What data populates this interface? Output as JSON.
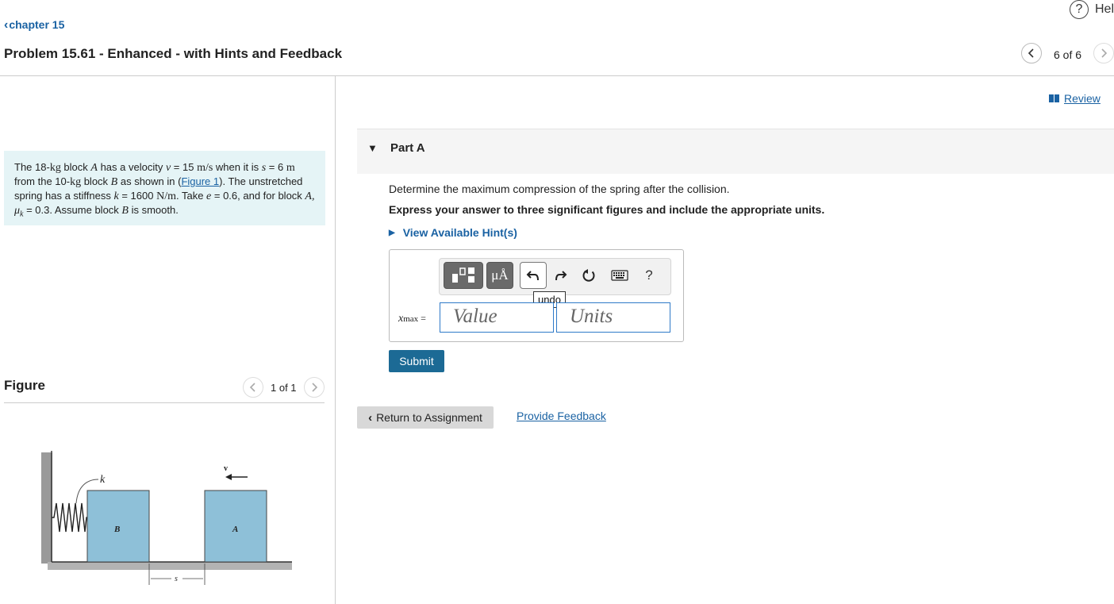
{
  "header": {
    "help_label": "Hel",
    "help_icon_glyph": "?",
    "back_label": "chapter 15",
    "title": "Problem 15.61 - Enhanced - with Hints and Feedback",
    "counter": "6 of 6",
    "review_label": "Review"
  },
  "statement": {
    "t1": "The 18-",
    "u_kg1": "kg",
    "t2": " block ",
    "A1": "A",
    "t3": " has a velocity ",
    "v": "v",
    "t4": " = 15 ",
    "u_mps": "m/s",
    "t5": " when it is ",
    "s": "s",
    "t6": " = 6 ",
    "u_m": "m",
    "t7": " from the 10-",
    "u_kg2": "kg",
    "t8": " block ",
    "B1": "B",
    "t9": " as shown in (",
    "figure_link": "Figure 1",
    "t10": "). The unstretched spring has a stiffness ",
    "k": "k",
    "t11": " = 1600 ",
    "u_npm": "N/m",
    "t12": ". Take ",
    "e": "e",
    "t13": " = 0.6, and for block ",
    "A2": "A, μ",
    "k_sub": "k",
    "t14": " = 0.3. Assume block ",
    "B2": "B",
    "t15": " is smooth."
  },
  "figure": {
    "title": "Figure",
    "counter": "1 of 1",
    "labels": {
      "k": "k",
      "v": "v",
      "B": "B",
      "A": "A",
      "s": "s"
    },
    "block_color": "#8ec0d8"
  },
  "part": {
    "title": "Part A",
    "question": "Determine the maximum compression of the spring after the collision.",
    "instructions": "Express your answer to three significant figures and include the appropriate units.",
    "hints_label": "View Available Hint(s)"
  },
  "answer": {
    "var_main": "x",
    "var_sub": "max",
    "equals": " =",
    "value_placeholder": "Value",
    "units_placeholder": "Units",
    "symbols_label": "μÅ",
    "help_label": "?",
    "undo_tooltip": "undo"
  },
  "actions": {
    "submit": "Submit",
    "return": "Return to Assignment",
    "feedback": "Provide Feedback"
  },
  "colors": {
    "link": "#1a62a3",
    "submit_bg": "#1c6a95",
    "statement_bg": "#e5f4f6",
    "input_border": "#2f7ac8"
  }
}
